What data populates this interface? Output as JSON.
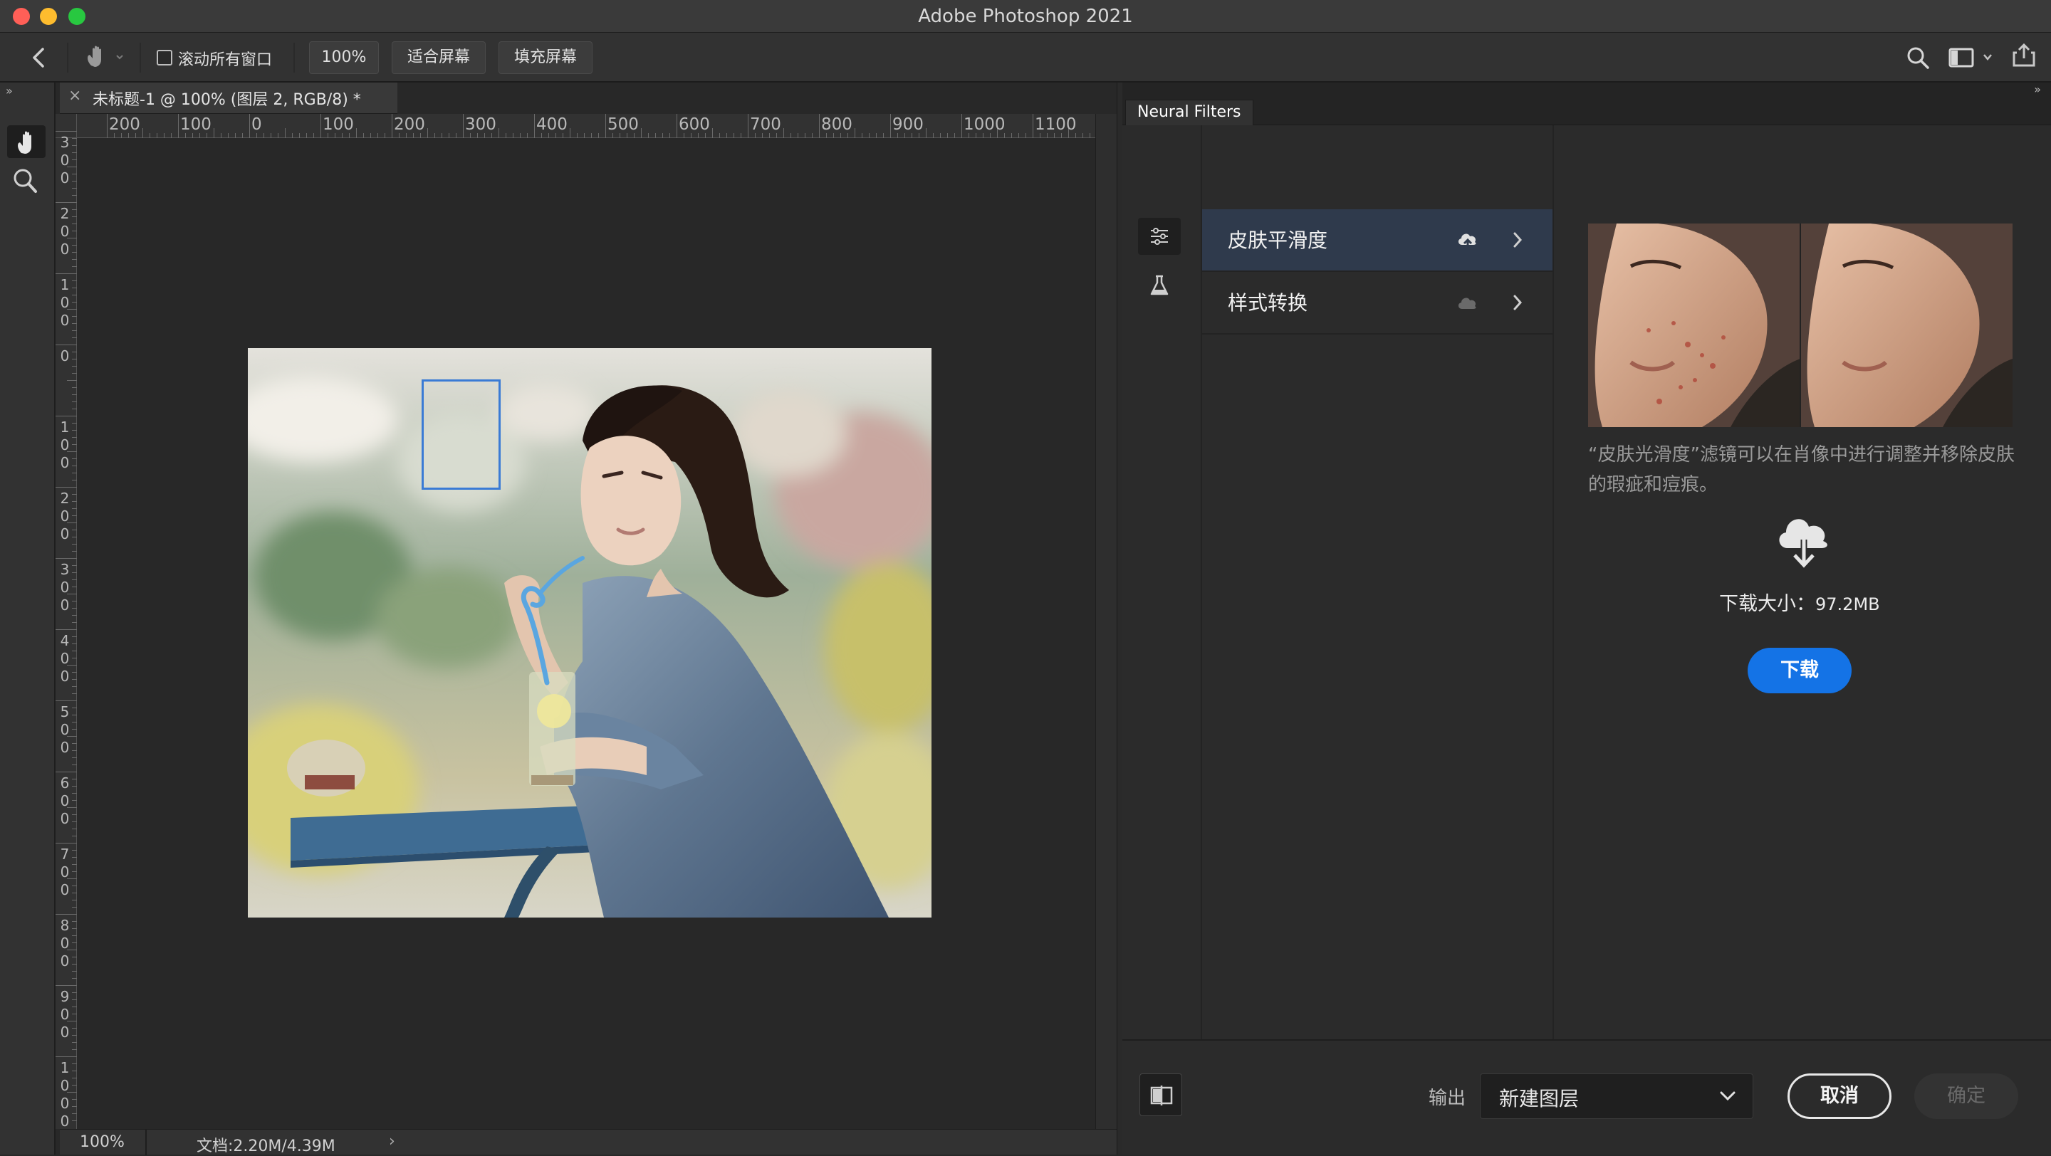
{
  "window": {
    "title": "Adobe Photoshop 2021"
  },
  "options_bar": {
    "scroll_all_label": "滚动所有窗口",
    "zoom_100_label": "100%",
    "fit_screen_label": "适合屏幕",
    "fill_screen_label": "填充屏幕"
  },
  "document": {
    "tab_title": "未标题-1 @ 100% (图层 2, RGB/8) *",
    "close_glyph": "×"
  },
  "rulers": {
    "top_labels": [
      "200",
      "100",
      "0",
      "100",
      "200",
      "300",
      "400",
      "500",
      "600",
      "700",
      "800",
      "900",
      "1000",
      "1100"
    ],
    "left_labels": [
      "300",
      "200",
      "100",
      "0",
      "100",
      "200",
      "300",
      "400",
      "500",
      "600",
      "700",
      "800",
      "900",
      "1000"
    ]
  },
  "status": {
    "zoom": "100%",
    "doc_size": "文档:2.20M/4.39M",
    "arrow": "›"
  },
  "panel": {
    "tab_label": "Neural Filters",
    "filters": [
      {
        "label": "皮肤平滑度",
        "icon": "cloud-upload-icon"
      },
      {
        "label": "样式转换",
        "icon": "cloud-icon"
      }
    ],
    "description": "“皮肤光滑度”滤镜可以在肖像中进行调整并移除皮肤的瑕疵和痘痕。",
    "download_size_label": "下载大小：",
    "download_size_value": "97.2MB",
    "download_button": "下载",
    "output_label": "输出",
    "output_value": "新建图层",
    "cancel_button": "取消",
    "ok_button": "确定"
  },
  "colors": {
    "accent_blue": "#1473e6",
    "selection_blue": "#3a7bd5",
    "selected_row": "#2f3a4c"
  }
}
